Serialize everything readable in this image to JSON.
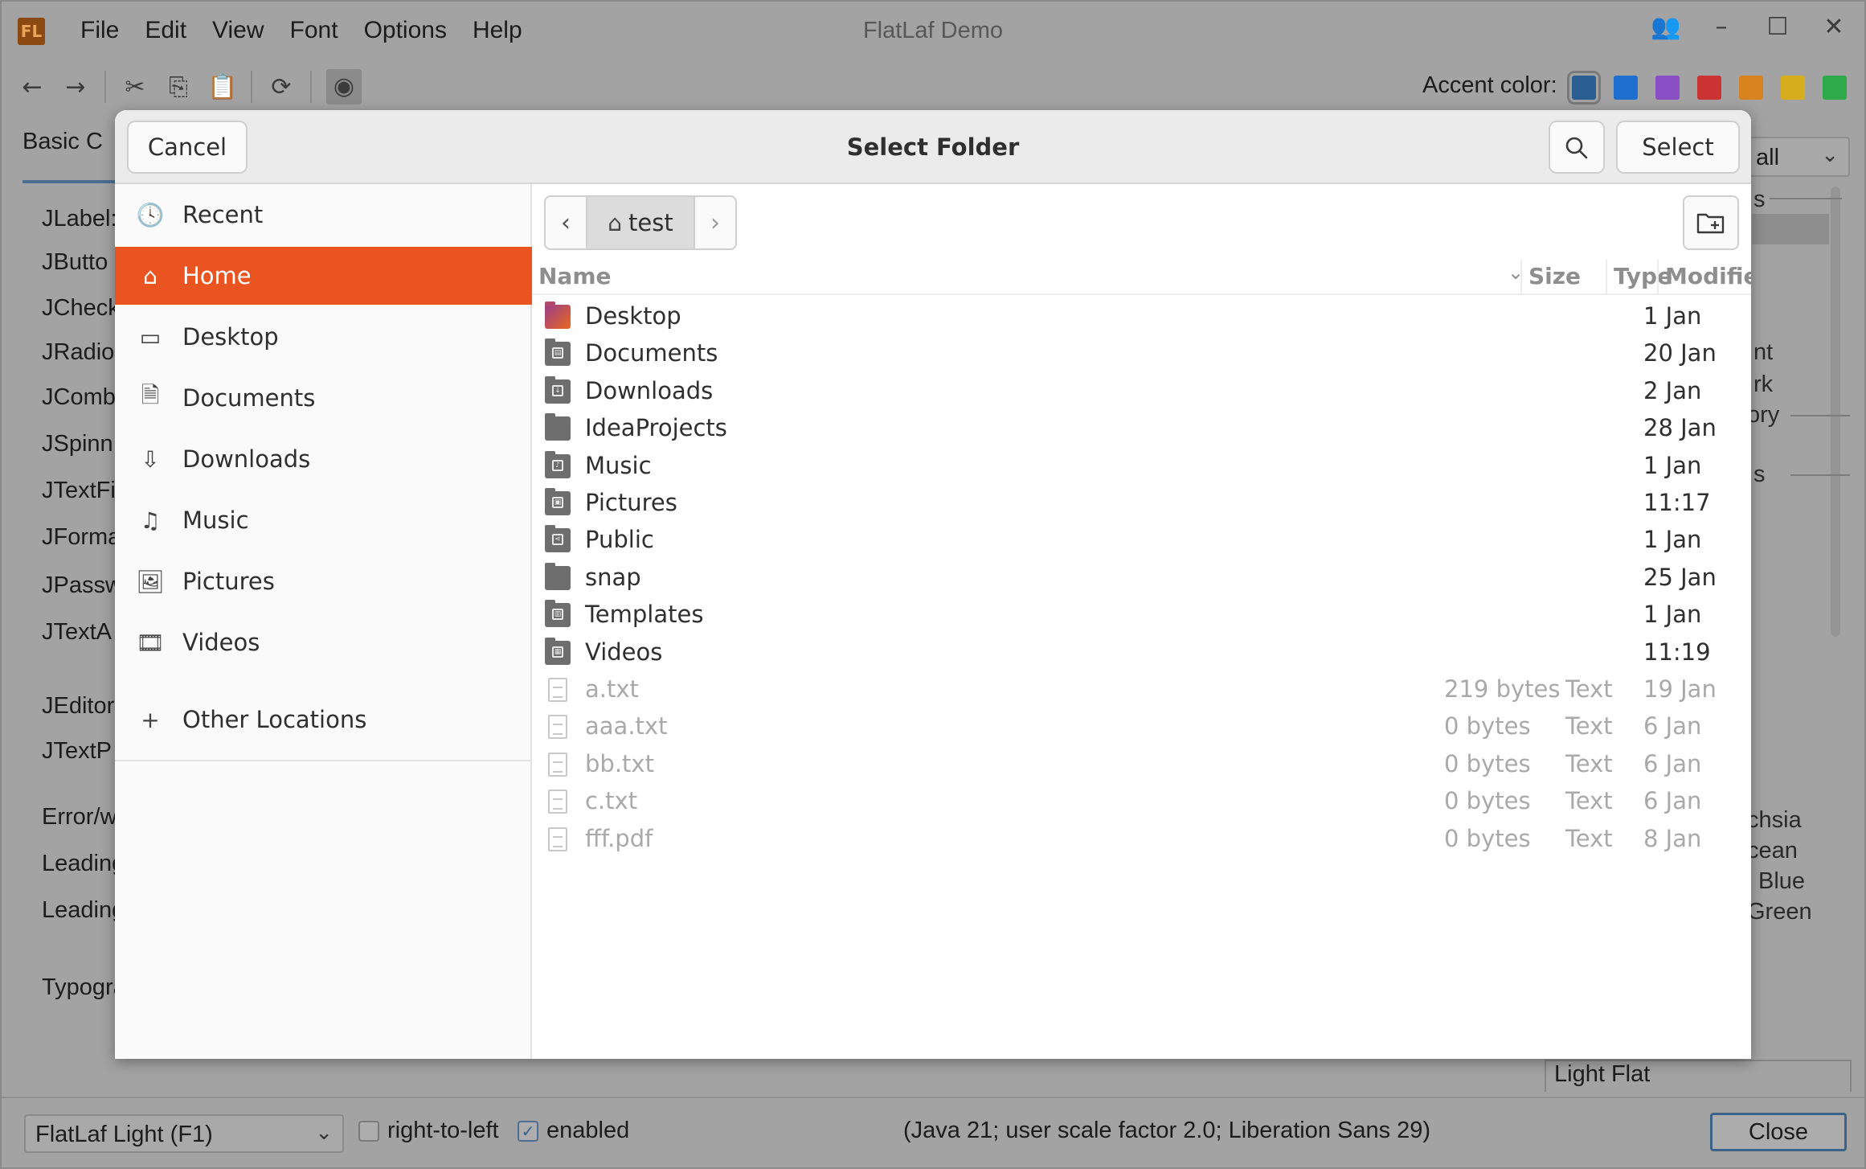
{
  "app": {
    "logo_text": "FL",
    "title": "FlatLaf Demo",
    "menu": [
      "File",
      "Edit",
      "View",
      "Font",
      "Options",
      "Help"
    ]
  },
  "toolbar": {
    "accent_label": "Accent color:",
    "accent_colors": [
      "#2b5f93",
      "#1f6fd0",
      "#8a4fc4",
      "#cc3333",
      "#d9831f",
      "#d6ad1c",
      "#2faa4a"
    ]
  },
  "background": {
    "tab_label": "Basic C",
    "left_items": [
      "JLabel:",
      "JButto",
      "JCheck",
      "JRadio",
      "JComb",
      "JSpinn",
      "JTextFi",
      "JForma",
      "JPassw",
      "JTextA",
      "JEditor",
      "JTextP",
      "Error/w",
      "Leading",
      "Leading",
      "Typogra"
    ],
    "combo_value": "all",
    "right_texts": [
      "s",
      "nt",
      "rk",
      "ory",
      "s",
      "chsia",
      "cean",
      "Blue",
      "Green"
    ],
    "listbox_value": "Light Flat"
  },
  "status": {
    "laf_value": "FlatLaf Light (F1)",
    "rtl_label": "right-to-left",
    "enabled_label": "enabled",
    "rtl_checked": false,
    "enabled_checked": true,
    "info_text": "(Java 21;  user scale factor 2.0; Liberation Sans 29)",
    "close_label": "Close"
  },
  "dialog": {
    "title": "Select Folder",
    "cancel_label": "Cancel",
    "select_label": "Select",
    "path_crumb": "test",
    "sidebar": [
      {
        "label": "Recent",
        "icon": "clock-icon",
        "active": false
      },
      {
        "label": "Home",
        "icon": "home-icon",
        "active": true
      },
      {
        "label": "Desktop",
        "icon": "desktop-icon",
        "active": false
      },
      {
        "label": "Documents",
        "icon": "document-icon",
        "active": false
      },
      {
        "label": "Downloads",
        "icon": "download-icon",
        "active": false
      },
      {
        "label": "Music",
        "icon": "music-icon",
        "active": false
      },
      {
        "label": "Pictures",
        "icon": "picture-icon",
        "active": false
      },
      {
        "label": "Videos",
        "icon": "video-icon",
        "active": false
      }
    ],
    "other_locations": "Other Locations",
    "columns": {
      "name": "Name",
      "size": "Size",
      "type": "Type",
      "modified": "Modified"
    },
    "files": [
      {
        "name": "Desktop",
        "size": "",
        "type": "",
        "modified": "1 Jan",
        "kind": "folder-desktop"
      },
      {
        "name": "Documents",
        "size": "",
        "type": "",
        "modified": "20 Jan",
        "kind": "folder-documents"
      },
      {
        "name": "Downloads",
        "size": "",
        "type": "",
        "modified": "2 Jan",
        "kind": "folder-downloads"
      },
      {
        "name": "IdeaProjects",
        "size": "",
        "type": "",
        "modified": "28 Jan",
        "kind": "folder"
      },
      {
        "name": "Music",
        "size": "",
        "type": "",
        "modified": "1 Jan",
        "kind": "folder-music"
      },
      {
        "name": "Pictures",
        "size": "",
        "type": "",
        "modified": "11:17",
        "kind": "folder-pictures"
      },
      {
        "name": "Public",
        "size": "",
        "type": "",
        "modified": "1 Jan",
        "kind": "folder-public"
      },
      {
        "name": "snap",
        "size": "",
        "type": "",
        "modified": "25 Jan",
        "kind": "folder"
      },
      {
        "name": "Templates",
        "size": "",
        "type": "",
        "modified": "1 Jan",
        "kind": "folder-templates"
      },
      {
        "name": "Videos",
        "size": "",
        "type": "",
        "modified": "11:19",
        "kind": "folder-videos"
      },
      {
        "name": "a.txt",
        "size": "219 bytes",
        "type": "Text",
        "modified": "19 Jan",
        "kind": "text-file"
      },
      {
        "name": "aaa.txt",
        "size": "0 bytes",
        "type": "Text",
        "modified": "6 Jan",
        "kind": "text-file"
      },
      {
        "name": "bb.txt",
        "size": "0 bytes",
        "type": "Text",
        "modified": "6 Jan",
        "kind": "text-file"
      },
      {
        "name": "c.txt",
        "size": "0 bytes",
        "type": "Text",
        "modified": "6 Jan",
        "kind": "text-file"
      },
      {
        "name": "fff.pdf",
        "size": "0 bytes",
        "type": "Text",
        "modified": "8 Jan",
        "kind": "text-file"
      }
    ]
  }
}
